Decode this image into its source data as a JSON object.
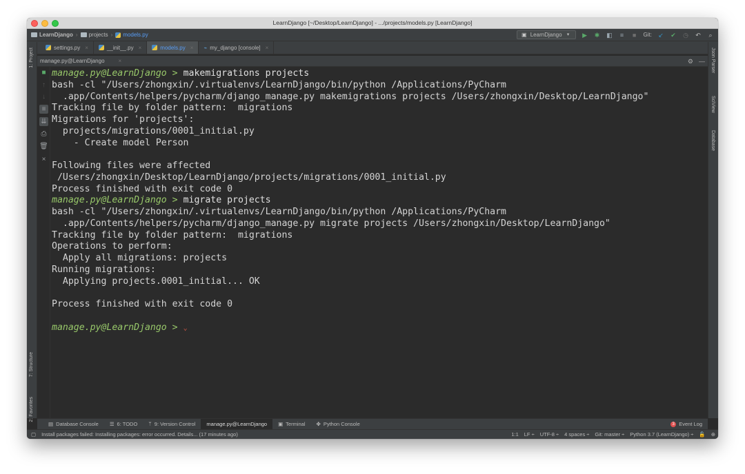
{
  "window": {
    "title": "LearnDjango [~/Desktop/LearnDjango] - .../projects/models.py [LearnDjango]"
  },
  "navbar": {
    "breadcrumbs": [
      "LearnDjango",
      "projects",
      "models.py"
    ],
    "run_config": "LearnDjango",
    "git_label": "Git:"
  },
  "editor_tabs": [
    {
      "label": "settings.py",
      "icon": "python-file-icon"
    },
    {
      "label": "__init__.py",
      "icon": "python-file-icon"
    },
    {
      "label": "models.py",
      "icon": "python-file-icon",
      "active": true
    },
    {
      "label": "my_django [console]",
      "icon": "console-icon"
    }
  ],
  "left_stripe": {
    "project": "1: Project",
    "structure": "7: Structure",
    "favorites": "2: Favorites"
  },
  "right_stripe": {
    "json_parser": "Json Parser",
    "sciview": "SciView",
    "database": "Database"
  },
  "panel": {
    "tab_label": "manage.py@LearnDjango"
  },
  "console": {
    "lines": [
      {
        "prompt": "manage.py@LearnDjango >",
        "text": " makemigrations projects"
      },
      {
        "text": "bash -cl \"/Users/zhongxin/.virtualenvs/LearnDjango/bin/python /Applications/PyCharm"
      },
      {
        "text": "  .app/Contents/helpers/pycharm/django_manage.py makemigrations projects /Users/zhongxin/Desktop/LearnDjango\""
      },
      {
        "text": "Tracking file by folder pattern:  migrations"
      },
      {
        "text": "Migrations for 'projects':"
      },
      {
        "text": "  projects/migrations/0001_initial.py"
      },
      {
        "text": "    - Create model Person"
      },
      {
        "text": ""
      },
      {
        "text": "Following files were affected "
      },
      {
        "text": " /Users/zhongxin/Desktop/LearnDjango/projects/migrations/0001_initial.py"
      },
      {
        "text": "Process finished with exit code 0"
      },
      {
        "prompt": "manage.py@LearnDjango >",
        "text": " migrate projects"
      },
      {
        "text": "bash -cl \"/Users/zhongxin/.virtualenvs/LearnDjango/bin/python /Applications/PyCharm"
      },
      {
        "text": "  .app/Contents/helpers/pycharm/django_manage.py migrate projects /Users/zhongxin/Desktop/LearnDjango\""
      },
      {
        "text": "Tracking file by folder pattern:  migrations"
      },
      {
        "text": "Operations to perform:"
      },
      {
        "text": "  Apply all migrations: projects"
      },
      {
        "text": "Running migrations:"
      },
      {
        "text": "  Applying projects.0001_initial... OK"
      },
      {
        "text": ""
      },
      {
        "text": "Process finished with exit code 0"
      },
      {
        "text": ""
      },
      {
        "prompt": "manage.py@LearnDjango >",
        "text": " "
      }
    ]
  },
  "toolwindows": {
    "database_console": "Database Console",
    "todo": "6: TODO",
    "version_control": "9: Version Control",
    "manage": "manage.py@LearnDjango",
    "terminal": "Terminal",
    "python_console": "Python Console",
    "event_log": "Event Log",
    "event_count": "3"
  },
  "statusbar": {
    "message": "Install packages failed: Installing packages: error occurred. Details... (17 minutes ago)",
    "position": "1:1",
    "line_sep": "LF ÷",
    "encoding": "UTF-8 ÷",
    "indent": "4 spaces ÷",
    "git": "Git: master ÷",
    "interpreter": "Python 3.7 (LearnDjango) ÷"
  }
}
